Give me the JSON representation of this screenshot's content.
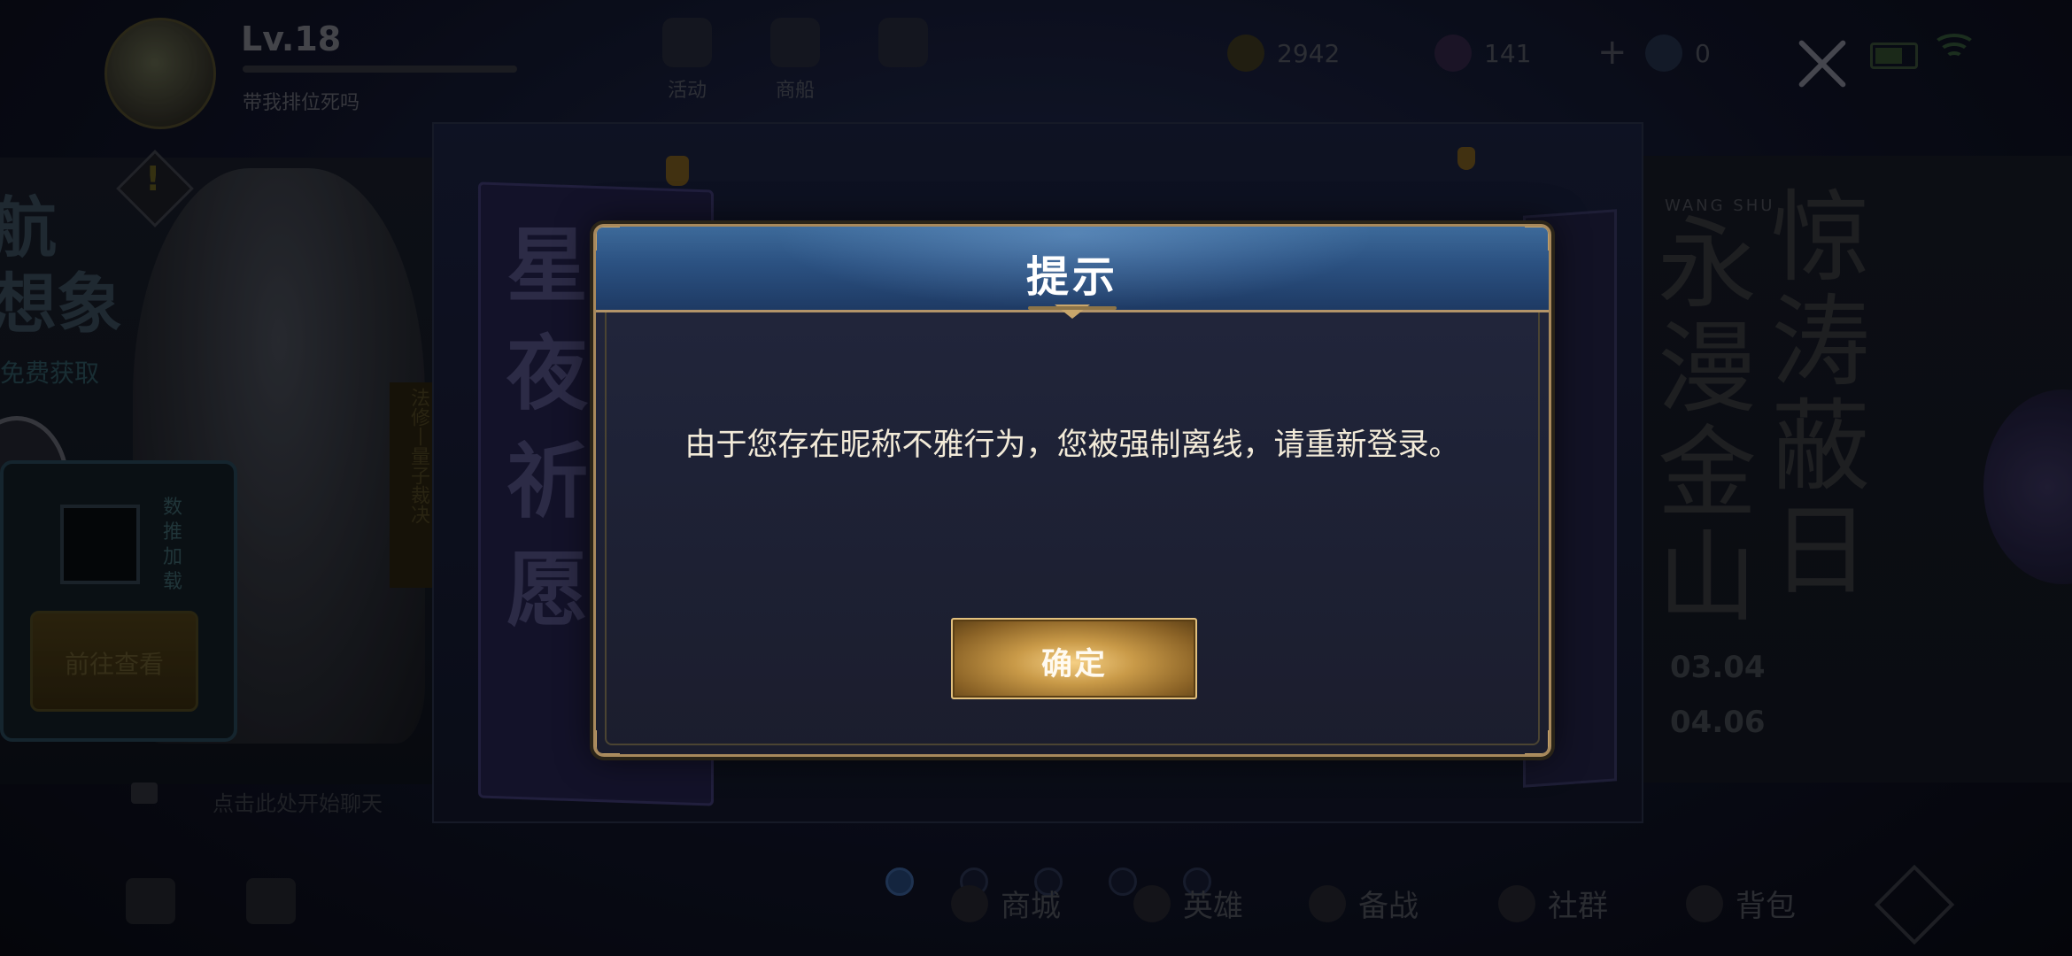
{
  "player": {
    "level": "Lv.18",
    "nickname": "带我排位死吗"
  },
  "top_menu": [
    {
      "label": "活动",
      "icon": "megaphone-icon"
    },
    {
      "label": "商船",
      "icon": "ship-icon"
    },
    {
      "label": "",
      "icon": "gift-icon"
    }
  ],
  "currencies": [
    {
      "icon": "gold-coin-icon",
      "value": "2942"
    },
    {
      "icon": "diamond-icon",
      "value": "141"
    },
    {
      "icon": "crystal-icon",
      "value": "0"
    }
  ],
  "left_banner": {
    "title_line1": "航",
    "title_line2": "想象",
    "subtitle": "免费获取",
    "side_label": "数推加载",
    "vertical_label": "法修丨量子裁决",
    "goto_button": "前往查看",
    "chat_hint": "点击此处开始聊天"
  },
  "center_book": {
    "text": "星夜祈愿"
  },
  "right_banner": {
    "tag": "WANG SHU",
    "calligraphy_1": "永漫金山",
    "calligraphy_2": "惊涛蔽日",
    "date_start": "03.04",
    "date_end": "04.06"
  },
  "bottom_nav": [
    {
      "label": "商城",
      "icon": "shop-icon"
    },
    {
      "label": "英雄",
      "icon": "hero-icon"
    },
    {
      "label": "备战",
      "icon": "prepare-icon"
    },
    {
      "label": "社群",
      "icon": "community-icon"
    },
    {
      "label": "背包",
      "icon": "backpack-icon"
    }
  ],
  "page_indicator": {
    "count": 5,
    "active": 0
  },
  "dialog": {
    "title": "提示",
    "message": "由于您存在昵称不雅行为，您被强制离线，请重新登录。",
    "confirm_label": "确定"
  },
  "colors": {
    "dialog_header": "#2b5181",
    "dialog_border": "#a8895c",
    "button_gold": "#c99a48",
    "message_text": "#f2ead8"
  }
}
